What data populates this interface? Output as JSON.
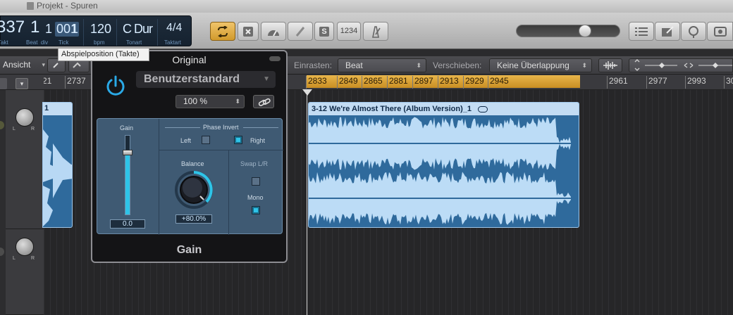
{
  "window": {
    "title": "Projekt - Spuren"
  },
  "lcd": {
    "bar": "337",
    "beat": "1",
    "div": "1",
    "tick": "001",
    "tick_last": "1",
    "tempo": "120",
    "key": "C Dur",
    "time_sig": "4/4",
    "labels": {
      "takt": "Takt",
      "beat_div": "Beat  div",
      "tick": "Tick",
      "bpm": "bpm",
      "tonart": "Tonart",
      "taktart": "Taktart"
    }
  },
  "toolbar": {
    "cycle_icon": "cycle-icon",
    "count_in": "1234",
    "mixer_icon": "list-icon"
  },
  "tooltip": {
    "text": "Abspielposition (Takte)"
  },
  "editor_header": {
    "view_label": "Ansicht",
    "snap_label": "Einrasten:",
    "snap_value": "Beat",
    "drag_label": "Verschieben:",
    "drag_value": "Keine Überlappung"
  },
  "ruler": {
    "ticks": [
      "21",
      "2737",
      "2833",
      "2849",
      "2865",
      "2881",
      "2897",
      "2913",
      "2929",
      "2945",
      "2961",
      "2977",
      "2993",
      "30"
    ]
  },
  "region": {
    "name": "3-12 We're Almost There (Album Version)_1",
    "left_marker": "1"
  },
  "plugin": {
    "title": "Original",
    "preset": "Benutzerstandard",
    "zoom": "100 %",
    "gain_label": "Gain",
    "gain_value": "0.0",
    "phase_invert_label": "Phase Invert",
    "left_label": "Left",
    "right_label": "Right",
    "left_checked": false,
    "right_checked": true,
    "balance_label": "Balance",
    "balance_value": "+80.0%",
    "swap_label": "Swap L/R",
    "mono_label": "Mono",
    "swap_checked": false,
    "mono_checked": true,
    "plugin_name": "Gain"
  },
  "colors": {
    "accent": "#2ec4e8",
    "cycle": "#d9a13a",
    "region": "#2f6a9c"
  }
}
